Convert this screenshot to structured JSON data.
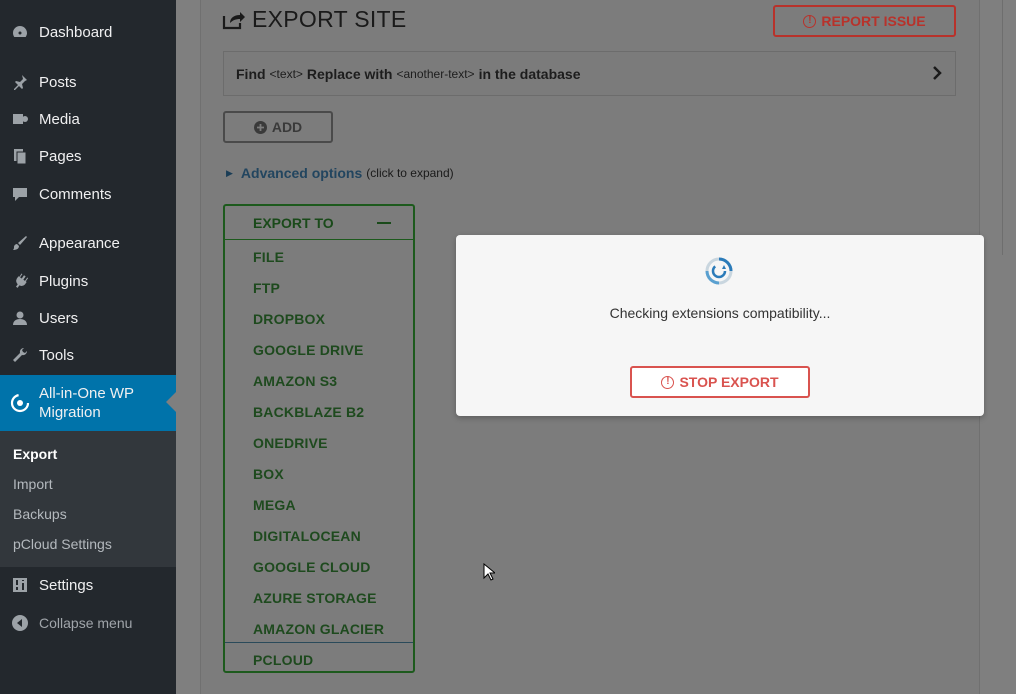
{
  "sidebar": {
    "items": [
      {
        "label": "Dashboard",
        "icon": "dashboard-icon"
      },
      {
        "label": "Posts",
        "icon": "pin-icon"
      },
      {
        "label": "Media",
        "icon": "media-icon"
      },
      {
        "label": "Pages",
        "icon": "pages-icon"
      },
      {
        "label": "Comments",
        "icon": "comment-icon"
      },
      {
        "label": "Appearance",
        "icon": "brush-icon"
      },
      {
        "label": "Plugins",
        "icon": "plugin-icon"
      },
      {
        "label": "Users",
        "icon": "user-icon"
      },
      {
        "label": "Tools",
        "icon": "wrench-icon"
      }
    ],
    "active": {
      "label_line1": "All-in-One WP",
      "label_line2": "Migration",
      "icon": "migration-icon"
    },
    "submenu": [
      "Export",
      "Import",
      "Backups",
      "pCloud Settings"
    ],
    "settings": "Settings",
    "collapse": "Collapse menu"
  },
  "header": {
    "title": "EXPORT SITE",
    "report_issue": "REPORT ISSUE"
  },
  "find_replace": {
    "find": "Find",
    "text_tag": "<text>",
    "replace_with": "Replace with",
    "another_tag": "<another-text>",
    "suffix": "in the database"
  },
  "add_button": "ADD",
  "advanced": {
    "link": "Advanced options",
    "hint": "(click to expand)"
  },
  "export_to": {
    "title": "EXPORT TO",
    "items": [
      "FILE",
      "FTP",
      "DROPBOX",
      "GOOGLE DRIVE",
      "AMAZON S3",
      "BACKBLAZE B2",
      "ONEDRIVE",
      "BOX",
      "MEGA",
      "DIGITALOCEAN",
      "GOOGLE CLOUD",
      "AZURE STORAGE",
      "AMAZON GLACIER",
      "PCLOUD"
    ]
  },
  "modal": {
    "message": "Checking extensions compatibility...",
    "stop_button": "STOP EXPORT"
  },
  "colors": {
    "sidebar_bg": "#23282d",
    "active_bg": "#0073aa",
    "danger": "#d9534f",
    "export_green": "#1d5a1d"
  }
}
